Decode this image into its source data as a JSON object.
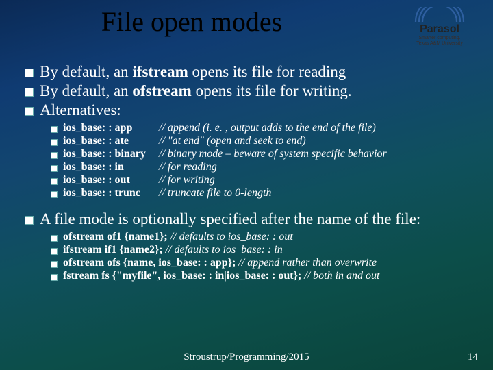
{
  "title": "File open modes",
  "logo": {
    "brand": "Parasol",
    "tag1": "Smarter computing.",
    "tag2": "Texas A&M University"
  },
  "bullets": {
    "b1_pre": "By default, an ",
    "b1_bold": "ifstream",
    "b1_post": " opens its file for reading",
    "b2_pre": "By default, an ",
    "b2_bold": "ofstream",
    "b2_post": " opens its file for writing.",
    "b3": "Alternatives:",
    "b4": "A file mode is optionally specified after the name of the file:"
  },
  "modes": [
    {
      "name": "ios_base: : app",
      "comment": "// append (i. e. , output adds to the end of the file)"
    },
    {
      "name": "ios_base: : ate",
      "comment": "// \"at end\" (open and seek to end)"
    },
    {
      "name": "ios_base: : binary",
      "comment": "// binary mode – beware of system specific behavior"
    },
    {
      "name": "ios_base: : in",
      "comment": "// for reading"
    },
    {
      "name": "ios_base: : out",
      "comment": "// for writing"
    },
    {
      "name": "ios_base: : trunc",
      "comment": "// truncate file to 0-length"
    }
  ],
  "examples": [
    {
      "code": "ofstream of1 {name1}; ",
      "comment": " // defaults to ios_base: : out"
    },
    {
      "code": "ifstream if1 {name2}; ",
      "comment": "    // defaults to ios_base: : in"
    },
    {
      "code": "ofstream ofs {name, ios_base: : app}; ",
      "comment": "  // append rather than overwrite"
    },
    {
      "code": "fstream fs {\"myfile\", ios_base: : in|ios_base: : out}; ",
      "comment": "  // both in and out"
    }
  ],
  "footer": {
    "center": "Stroustrup/Programming/2015",
    "page": "14"
  }
}
